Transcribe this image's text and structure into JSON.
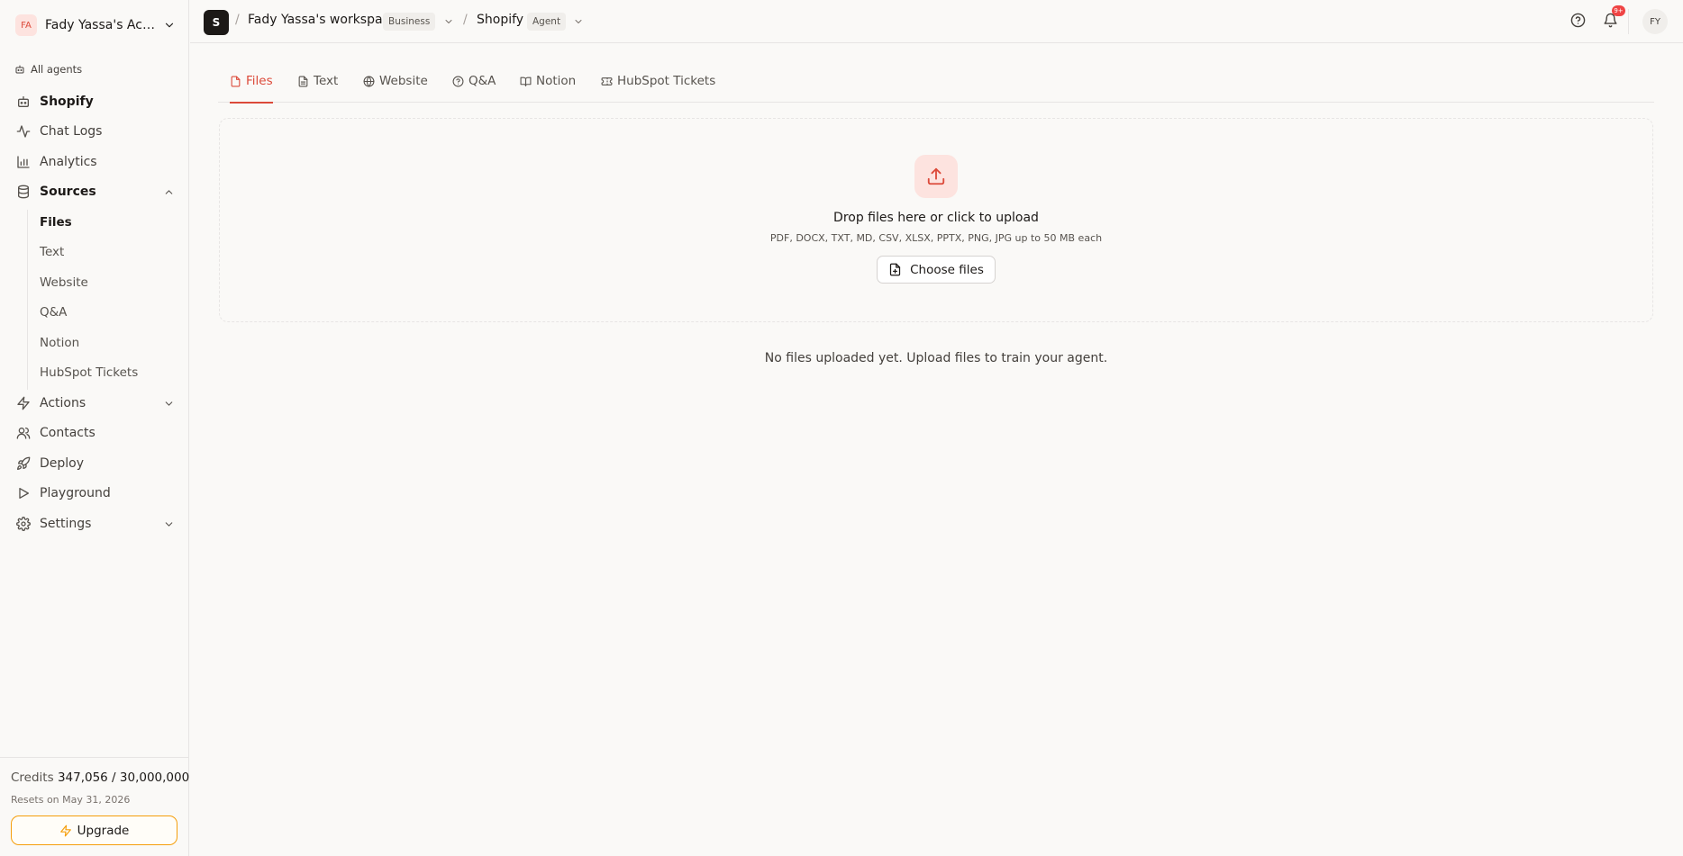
{
  "account": {
    "initials": "FA",
    "name": "Fady Yassa's Acco..."
  },
  "sidebar": {
    "all_agents_label": "All agents",
    "agent_name": "Shopify",
    "items": {
      "chat_logs": "Chat Logs",
      "analytics": "Analytics",
      "sources": "Sources",
      "actions": "Actions",
      "contacts": "Contacts",
      "deploy": "Deploy",
      "playground": "Playground",
      "settings": "Settings"
    },
    "sources_sub": [
      "Files",
      "Text",
      "Website",
      "Q&A",
      "Notion",
      "HubSpot Tickets"
    ],
    "active_sub": "Files"
  },
  "credits": {
    "label": "Credits",
    "value": "347,056 / 30,000,000",
    "resets": "Resets on May 31, 2026",
    "upgrade_label": "Upgrade"
  },
  "header": {
    "workspace_initial": "S",
    "separator": "/",
    "workspace_name": "Fady Yassa's workspace",
    "workspace_badge": "Business",
    "agent_name": "Shopify",
    "agent_badge": "Agent",
    "notification_count": "9+",
    "user_initials": "FY"
  },
  "tabs": {
    "files": "Files",
    "text": "Text",
    "website": "Website",
    "qa": "Q&A",
    "notion": "Notion",
    "hubspot": "HubSpot Tickets",
    "active": "Files"
  },
  "dropzone": {
    "title": "Drop files here or click to upload",
    "hint": "PDF, DOCX, TXT, MD, CSV, XLSX, PPTX, PNG, JPG up to 50 MB each",
    "button_label": "Choose files"
  },
  "empty_state": "No files uploaded yet. Upload files to train your agent.",
  "colors": {
    "accent": "#dc4a3a",
    "accent_soft": "#fde3df",
    "upgrade_border": "#f59e0b",
    "background": "#faf9f7",
    "border": "#e7e5e4"
  }
}
